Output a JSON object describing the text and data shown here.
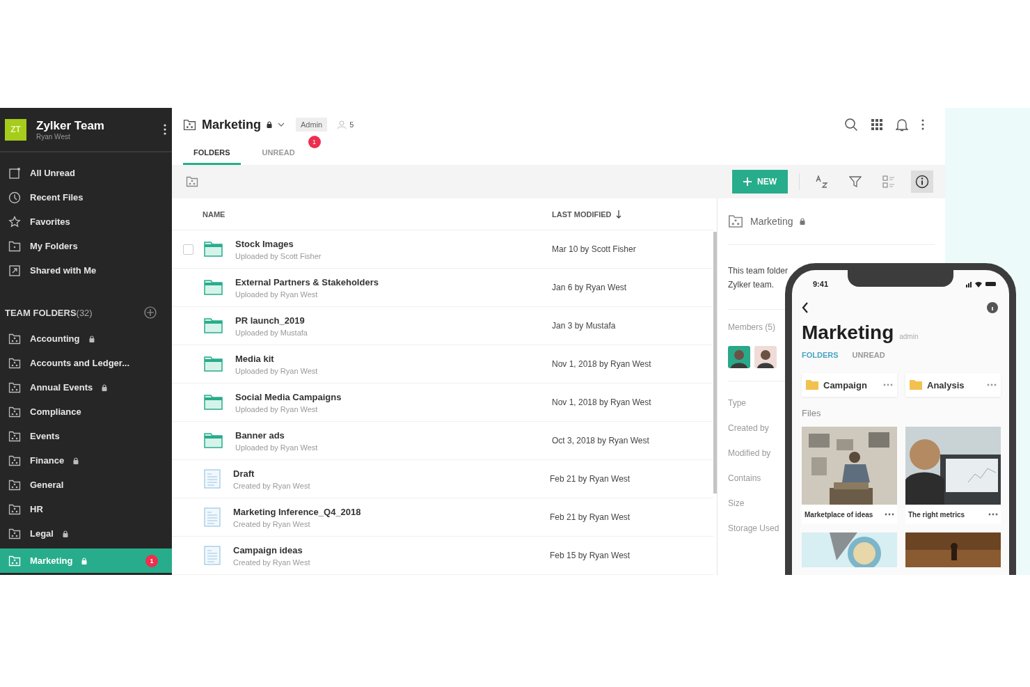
{
  "sidebar": {
    "logo": "ZT",
    "team": "Zylker Team",
    "user": "Ryan West",
    "nav": [
      "All Unread",
      "Recent Files",
      "Favorites",
      "My Folders",
      "Shared with Me"
    ],
    "team_folders_title": "TEAM FOLDERS",
    "team_folders_count": "(32)",
    "folders": [
      {
        "label": "Accounting",
        "locked": true,
        "selected": false
      },
      {
        "label": "Accounts and Ledger...",
        "locked": false,
        "selected": false
      },
      {
        "label": "Annual Events",
        "locked": true,
        "selected": false
      },
      {
        "label": "Compliance",
        "locked": false,
        "selected": false
      },
      {
        "label": "Events",
        "locked": false,
        "selected": false
      },
      {
        "label": "Finance",
        "locked": true,
        "selected": false
      },
      {
        "label": "General",
        "locked": false,
        "selected": false
      },
      {
        "label": "HR",
        "locked": false,
        "selected": false
      },
      {
        "label": "Legal",
        "locked": true,
        "selected": false
      },
      {
        "label": "Marketing",
        "locked": true,
        "selected": true,
        "badge": "1"
      }
    ]
  },
  "header": {
    "title": "Marketing",
    "locked": true,
    "role": "Admin",
    "members": "5",
    "tabs": [
      {
        "label": "FOLDERS",
        "selected": true
      },
      {
        "label": "UNREAD",
        "selected": false,
        "badge": "1"
      }
    ]
  },
  "toolbar": {
    "new_label": "NEW",
    "info_active": true
  },
  "table": {
    "columns": [
      "NAME",
      "LAST MODIFIED"
    ],
    "rows": [
      {
        "kind": "folder",
        "name": "Stock Images",
        "sub": "Uploaded by Scott Fisher",
        "modified": "Mar 10 by Scott Fisher",
        "checked": false
      },
      {
        "kind": "folder",
        "name": "External Partners & Stakeholders",
        "sub": "Uploaded by Ryan West",
        "modified": "Jan 6 by Ryan West"
      },
      {
        "kind": "folder",
        "name": "PR launch_2019",
        "sub": "Uploaded by Mustafa",
        "modified": "Jan 3 by Mustafa"
      },
      {
        "kind": "folder",
        "name": "Media kit",
        "sub": "Uploaded by Ryan West",
        "modified": "Nov 1, 2018 by Ryan West"
      },
      {
        "kind": "folder",
        "name": "Social Media Campaigns",
        "sub": "Uploaded by Ryan West",
        "modified": "Nov 1, 2018 by Ryan West"
      },
      {
        "kind": "folder",
        "name": "Banner ads",
        "sub": "Uploaded by Ryan West",
        "modified": "Oct 3, 2018 by Ryan West"
      },
      {
        "kind": "document",
        "name": "Draft",
        "sub": "Created by Ryan West",
        "modified": "Feb 21 by Ryan West"
      },
      {
        "kind": "document",
        "name": "Marketing Inference_Q4_2018",
        "sub": "Created by Ryan West",
        "modified": "Feb 21 by Ryan West"
      },
      {
        "kind": "document",
        "name": "Campaign ideas",
        "sub": "Created by Ryan West",
        "modified": "Feb 15 by Ryan West"
      }
    ]
  },
  "details": {
    "title": "Marketing",
    "locked": true,
    "description": [
      "This team folder",
      "Zylker team."
    ],
    "members_label": "Members (5)",
    "members": [
      {
        "color": "#2aa889"
      },
      {
        "color": "#f0dcd6"
      }
    ],
    "fields": [
      "Type",
      "Created by",
      "Modified by",
      "Contains",
      "Size",
      "Storage Used"
    ]
  },
  "phone": {
    "time": "9:41",
    "title": "Marketing",
    "role": "admin",
    "tabs": [
      {
        "label": "FOLDERS",
        "selected": true
      },
      {
        "label": "UNREAD",
        "selected": false
      }
    ],
    "folders": [
      "Campaign",
      "Analysis"
    ],
    "files_label": "Files",
    "files": [
      {
        "kind": "file",
        "caption": "Marketplace of ideas"
      },
      {
        "kind": "file",
        "caption": "The right metrics"
      },
      {
        "kind": "picture"
      },
      {
        "kind": "picture"
      }
    ]
  }
}
